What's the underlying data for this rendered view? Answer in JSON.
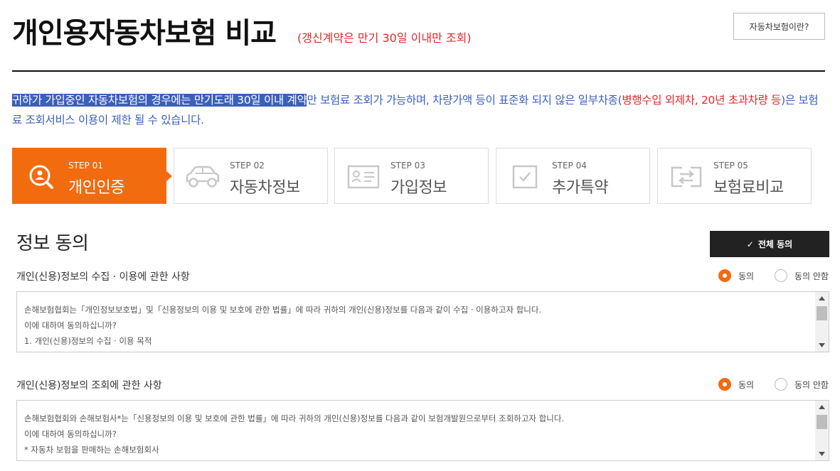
{
  "header": {
    "title": "개인용자동차보험 비교",
    "subtitle": "(갱신계약은 만기 30일 이내만 조회)",
    "what_button": "자동차보험이란?"
  },
  "notice": {
    "highlight": "귀하가 가입중인 자동차보험의 경우에는 만기도래 30일 이내 계약",
    "text1": "만 보험료 조회가 가능하며, 차량가액 등이 표준화 되지 않은 일부차종(",
    "red": "병행수입 외제차, 20년 초과차량 등",
    "text2": ")은 보험료 조회서비스 이용이 제한 될 수 있습니다."
  },
  "steps": [
    {
      "num": "STEP 01",
      "label": "개인인증",
      "icon": "person-search-icon",
      "active": true
    },
    {
      "num": "STEP 02",
      "label": "자동차정보",
      "icon": "car-icon",
      "active": false
    },
    {
      "num": "STEP 03",
      "label": "가입정보",
      "icon": "id-card-icon",
      "active": false
    },
    {
      "num": "STEP 04",
      "label": "추가특약",
      "icon": "checkbox-icon",
      "active": false
    },
    {
      "num": "STEP 05",
      "label": "보험료비교",
      "icon": "compare-arrows-icon",
      "active": false
    }
  ],
  "consent": {
    "title": "정보 동의",
    "all_button": "전체 동의",
    "sections": [
      {
        "question": "개인(신용)정보의 수집 · 이용에 관한 사항",
        "agree": "동의",
        "disagree": "동의 안함",
        "selected": "agree",
        "lines": [
          "손해보험협회는「개인정보보호법」및「신용정보의 이용 및 보호에 관한 법률」에 따라 귀하의 개인(신용)정보를 다음과 같이 수집 · 이용하고자 합니다.",
          "이에 대하여 동의하십니까?",
          "1. 개인(신용)정보의 수집 · 이용 목적"
        ]
      },
      {
        "question": "개인(신용)정보의 조회에 관한 사항",
        "agree": "동의",
        "disagree": "동의 안함",
        "selected": "agree",
        "lines": [
          "손해보험협회와 손해보험사*는「신용정보의 이용 및 보호에 관한 법률」에 따라 귀하의 개인(신용)정보를 다음과 같이 보험개발원으로부터 조회하고자 합니다.",
          "이에 대하여 동의하십니까?",
          "* 자동차 보험을 판매하는 손해보험회사"
        ]
      }
    ]
  },
  "colors": {
    "accent": "#f26b0f",
    "notice_blue": "#3b5fc0",
    "red": "#e8262a",
    "dark": "#222222"
  }
}
